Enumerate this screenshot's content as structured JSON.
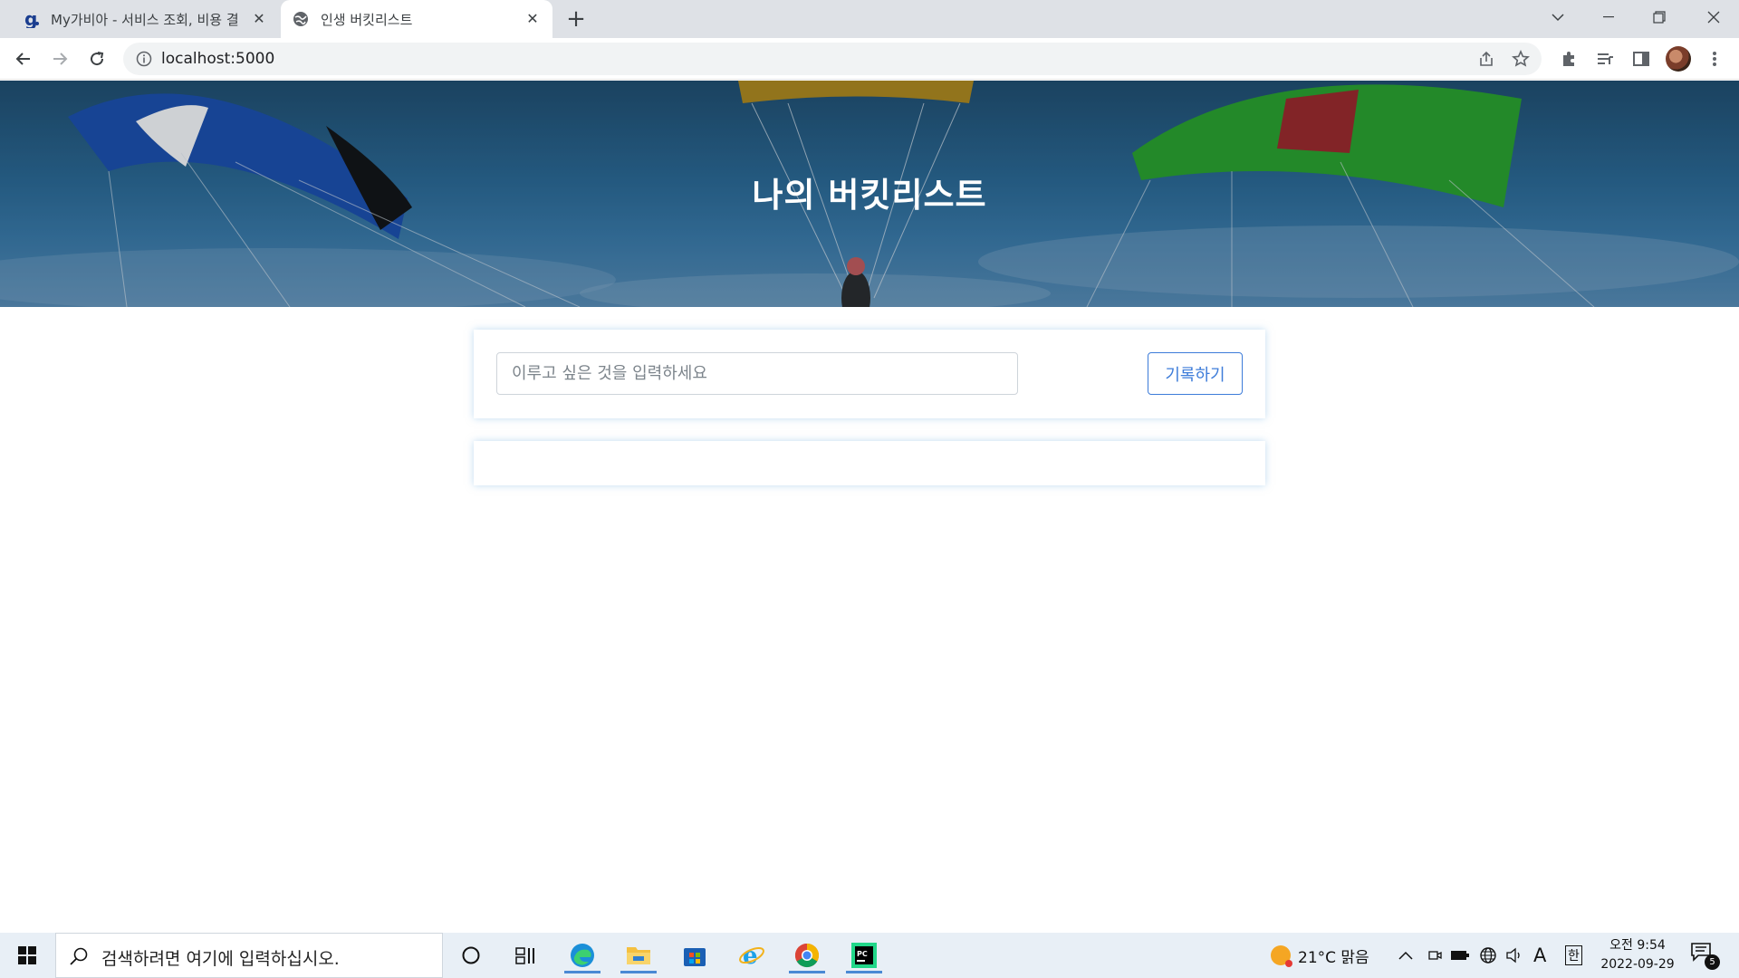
{
  "browser": {
    "tabs": [
      {
        "title": "My가비아 - 서비스 조회, 비용 결",
        "active": false,
        "favicon": "gabia-g-icon"
      },
      {
        "title": "인생 버킷리스트",
        "active": true,
        "favicon": "globe-icon"
      }
    ],
    "url": "localhost:5000"
  },
  "page": {
    "hero_title": "나의 버킷리스트",
    "input_placeholder": "이루고 싶은 것을 입력하세요",
    "record_button": "기록하기",
    "bucket_items": []
  },
  "taskbar": {
    "search_placeholder": "검색하려면 여기에 입력하십시오.",
    "weather": "21°C 맑음",
    "ime": "한",
    "font_indicator": "A",
    "clock_time": "오전 9:54",
    "clock_date": "2022-09-29",
    "notification_count": "5",
    "apps": [
      "cortana-icon",
      "task-view-icon",
      "edge-icon",
      "file-explorer-icon",
      "store-icon",
      "internet-explorer-icon",
      "chrome-icon",
      "pycharm-icon"
    ]
  },
  "colors": {
    "accent": "#3d7cd9",
    "hero_sky": "#2b6a96"
  }
}
